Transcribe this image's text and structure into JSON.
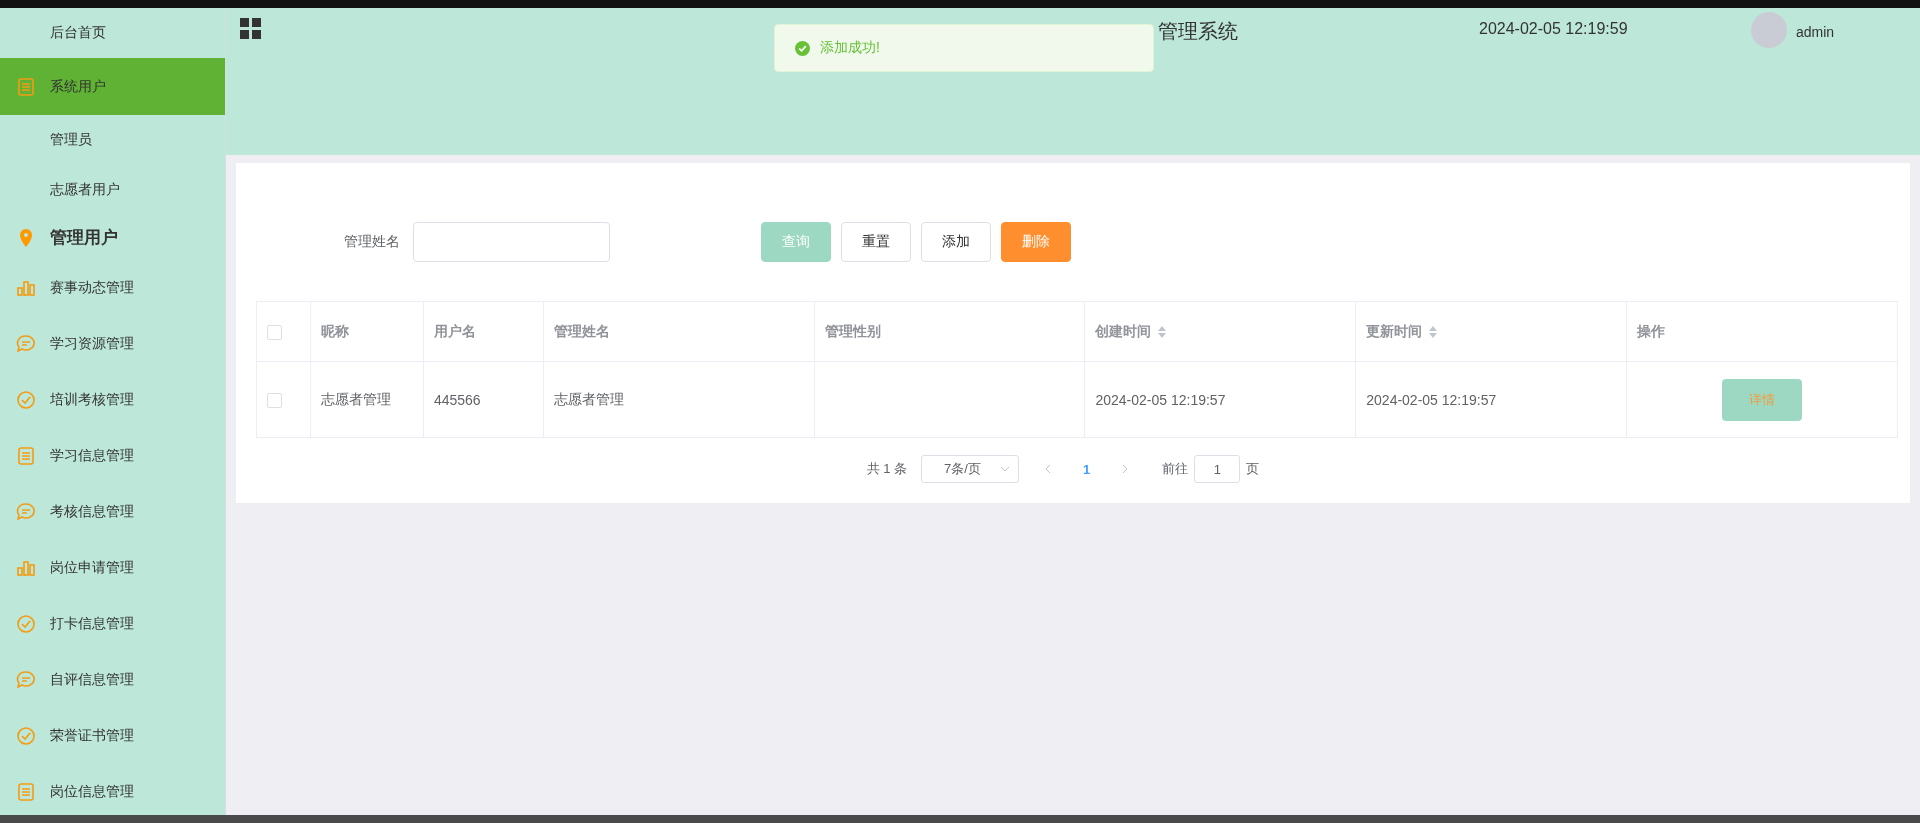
{
  "sidebar": {
    "items": [
      {
        "label": "后台首页",
        "kind": "plain",
        "selected": false
      },
      {
        "label": "系统用户",
        "kind": "group",
        "selected": true,
        "children": [
          {
            "label": "管理员",
            "selected": false
          },
          {
            "label": "志愿者用户",
            "selected": false
          }
        ]
      },
      {
        "label": "管理用户",
        "kind": "heading",
        "selected": false
      },
      {
        "label": "赛事动态管理",
        "kind": "plain",
        "selected": false
      },
      {
        "label": "学习资源管理",
        "kind": "plain",
        "selected": false
      },
      {
        "label": "培训考核管理",
        "kind": "plain",
        "selected": false
      },
      {
        "label": "学习信息管理",
        "kind": "plain",
        "selected": false
      },
      {
        "label": "考核信息管理",
        "kind": "plain",
        "selected": false
      },
      {
        "label": "岗位申请管理",
        "kind": "plain",
        "selected": false
      },
      {
        "label": "打卡信息管理",
        "kind": "plain",
        "selected": false
      },
      {
        "label": "自评信息管理",
        "kind": "plain",
        "selected": false
      },
      {
        "label": "荣誉证书管理",
        "kind": "plain",
        "selected": false
      },
      {
        "label": "岗位信息管理",
        "kind": "plain",
        "selected": false
      }
    ]
  },
  "header": {
    "title": "管理系统",
    "datetime": "2024-02-05 12:19:59",
    "user": "admin"
  },
  "toast": {
    "message": "添加成功!"
  },
  "filter": {
    "label": "管理姓名",
    "buttons": [
      {
        "label": "查询",
        "kind": "primary"
      },
      {
        "label": "重置",
        "kind": "default"
      },
      {
        "label": "添加",
        "kind": "default"
      },
      {
        "label": "删除",
        "kind": "danger"
      }
    ]
  },
  "table": {
    "columns": [
      {
        "label": "昵称",
        "sortable": false
      },
      {
        "label": "用户名",
        "sortable": false
      },
      {
        "label": "管理姓名",
        "sortable": false
      },
      {
        "label": "管理性别",
        "sortable": false
      },
      {
        "label": "创建时间",
        "sortable": true
      },
      {
        "label": "更新时间",
        "sortable": true
      },
      {
        "label": "操作",
        "sortable": false
      }
    ],
    "header_checked": false,
    "rows": [
      {
        "checked": false,
        "cells": [
          "志愿者管理",
          "445566",
          "志愿者管理",
          "",
          "2024-02-05 12:19:57",
          "2024-02-05 12:19:57"
        ],
        "action": "详情"
      }
    ]
  },
  "pagination": {
    "total": "共 1 条",
    "page_size": "7条/页",
    "pages": [
      {
        "label": "1",
        "selected": true
      }
    ],
    "goto_label": "前往",
    "goto_value": "1",
    "goto_suffix": "页"
  }
}
